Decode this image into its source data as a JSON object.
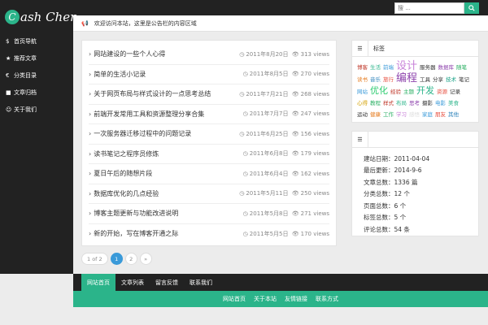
{
  "brand": {
    "initial": "C",
    "rest": "ash Chen"
  },
  "search": {
    "placeholder": "搜 ...",
    "button_icon": "search-icon"
  },
  "sidebar": {
    "items": [
      {
        "icon": "$",
        "icon_name": "dollar-icon",
        "label": "首页导航"
      },
      {
        "icon": "★",
        "icon_name": "star-icon",
        "label": "推荐文章"
      },
      {
        "icon": "€",
        "icon_name": "euro-icon",
        "label": "分类目录"
      },
      {
        "icon": "■",
        "icon_name": "book-icon",
        "label": "文章归档"
      },
      {
        "icon": "☺",
        "icon_name": "smile-icon",
        "label": "关于我们"
      }
    ]
  },
  "notice": {
    "text": "欢迎访问本站，这里是公告栏的内容区域"
  },
  "posts": [
    {
      "title": "网站建设的一些个人心得",
      "date": "2011年8月20日",
      "views": "313 views"
    },
    {
      "title": "简单的生活小记录",
      "date": "2011年8月5日",
      "views": "270 views"
    },
    {
      "title": "关于网页布局与样式设计的一点思考总结",
      "date": "2011年7月21日",
      "views": "268 views"
    },
    {
      "title": "前端开发常用工具和资源整理分享合集",
      "date": "2011年7月7日",
      "views": "247 views"
    },
    {
      "title": "一次服务器迁移过程中的问题记录",
      "date": "2011年6月25日",
      "views": "156 views"
    },
    {
      "title": "读书笔记之程序员修炼",
      "date": "2011年6月8日",
      "views": "179 views"
    },
    {
      "title": "夏日午后的随想片段",
      "date": "2011年6月4日",
      "views": "162 views"
    },
    {
      "title": "数据库优化的几点经验",
      "date": "2011年5月11日",
      "views": "250 views"
    },
    {
      "title": "博客主题更新与功能改进说明",
      "date": "2011年5月8日",
      "views": "271 views"
    },
    {
      "title": "新的开始，写在博客开通之际",
      "date": "2011年5月5日",
      "views": "170 views"
    }
  ],
  "pagination": {
    "info": "1 of 2",
    "pages": [
      "1",
      "2"
    ],
    "next": "»"
  },
  "tags_widget": {
    "title": "标签",
    "tags": [
      {
        "text": "博客",
        "color": "#c0392b",
        "size": "n"
      },
      {
        "text": "生活",
        "color": "#2bb48a",
        "size": "n"
      },
      {
        "text": "前端",
        "color": "#3a9ad9",
        "size": "n"
      },
      {
        "text": "设计",
        "color": "#c880d8",
        "size": "huge"
      },
      {
        "text": "服务器",
        "color": "#333",
        "size": "n"
      },
      {
        "text": "数据库",
        "color": "#8e44ad",
        "size": "n"
      },
      {
        "text": "随笔",
        "color": "#27ae60",
        "size": "n"
      },
      {
        "text": "读书",
        "color": "#e67e22",
        "size": "n"
      },
      {
        "text": "音乐",
        "color": "#2980b9",
        "size": "n"
      },
      {
        "text": "旅行",
        "color": "#e74c3c",
        "size": "n"
      },
      {
        "text": "编程",
        "color": "#8e44ad",
        "size": "huge"
      },
      {
        "text": "工具",
        "color": "#333",
        "size": "n"
      },
      {
        "text": "分享",
        "color": "#333",
        "size": "n"
      },
      {
        "text": "技术",
        "color": "#16a085",
        "size": "n"
      },
      {
        "text": "笔记",
        "color": "#333",
        "size": "n"
      },
      {
        "text": "网站",
        "color": "#3a9ad9",
        "size": "n"
      },
      {
        "text": "优化",
        "color": "#2ecc71",
        "size": "big"
      },
      {
        "text": "经验",
        "color": "#c0392b",
        "size": "n"
      },
      {
        "text": "主题",
        "color": "#27ae60",
        "size": "n"
      },
      {
        "text": "开发",
        "color": "#2bb48a",
        "size": "big"
      },
      {
        "text": "资源",
        "color": "#e74c3c",
        "size": "n"
      },
      {
        "text": "记录",
        "color": "#333",
        "size": "n"
      },
      {
        "text": "心得",
        "color": "#d4a000",
        "size": "n"
      },
      {
        "text": "教程",
        "color": "#27ae60",
        "size": "n"
      },
      {
        "text": "样式",
        "color": "#c0392b",
        "size": "n"
      },
      {
        "text": "布局",
        "color": "#2bb48a",
        "size": "n"
      },
      {
        "text": "思考",
        "color": "#8e44ad",
        "size": "n"
      },
      {
        "text": "摄影",
        "color": "#333",
        "size": "n"
      },
      {
        "text": "电影",
        "color": "#3a9ad9",
        "size": "n"
      },
      {
        "text": "美食",
        "color": "#2bb48a",
        "size": "n"
      },
      {
        "text": "运动",
        "color": "#333",
        "size": "n"
      },
      {
        "text": "健康",
        "color": "#e67e22",
        "size": "n"
      },
      {
        "text": "工作",
        "color": "#27ae60",
        "size": "n"
      },
      {
        "text": "学习",
        "color": "#c880d8",
        "size": "n"
      },
      {
        "text": "感悟",
        "color": "#ddd",
        "size": "n"
      },
      {
        "text": "家庭",
        "color": "#3a9ad9",
        "size": "n"
      },
      {
        "text": "朋友",
        "color": "#e74c3c",
        "size": "n"
      },
      {
        "text": "其他",
        "color": "#2980b9",
        "size": "n"
      }
    ]
  },
  "stats_widget": {
    "title": "",
    "rows": [
      "建站日期：2011-04-04",
      "最后更新：2014-9-6",
      "文章总数：1336 篇",
      "分类总数：12 个",
      "页面总数：6 个",
      "标签总数：5 个",
      "评论总数：54 条"
    ]
  },
  "navbar": {
    "items": [
      "网站首页",
      "文章列表",
      "留言反馈",
      "联系我们"
    ]
  },
  "footer": {
    "items": [
      "网站首页",
      "关于本站",
      "友情链接",
      "联系方式"
    ]
  },
  "colors": {
    "accent": "#2bb48a",
    "dark": "#222222",
    "page_active": "#3a9ad9"
  }
}
